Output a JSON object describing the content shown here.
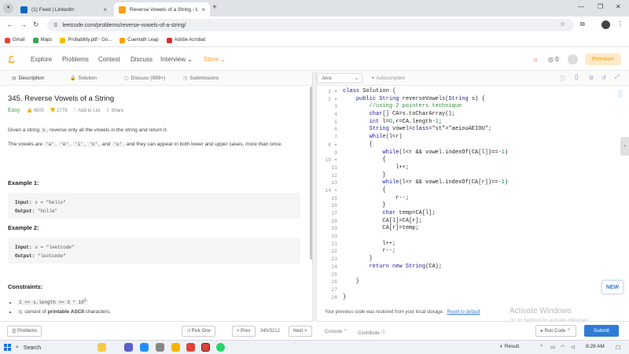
{
  "browser": {
    "tabs": [
      {
        "label": "(1) Feed | LinkedIn",
        "color": "#0a66c2"
      },
      {
        "label": "Reverse Vowels of a String - Lee",
        "color": "#f89f1b"
      }
    ],
    "url": "leetcode.com/problems/reverse-vowels-of-a-string/",
    "bookmarks": [
      {
        "label": "Gmail",
        "color": "#ea4335"
      },
      {
        "label": "Maps",
        "color": "#34a853"
      },
      {
        "label": "Probability.pdf - Go...",
        "color": "#fbbc04"
      },
      {
        "label": "Cuemath Leap",
        "color": "#f4a300"
      },
      {
        "label": "Adobe Acrobat",
        "color": "#d32f2f"
      }
    ]
  },
  "lc_nav": {
    "explore": "Explore",
    "problems": "Problems",
    "contest": "Contest",
    "discuss": "Discuss",
    "interview": "Interview",
    "store": "Store",
    "notif_count": "0",
    "premium": "Premium"
  },
  "left_tabs": {
    "description": "Description",
    "solution": "Solution",
    "discuss": "Discuss (999+)",
    "submissions": "Submissions"
  },
  "question": {
    "title": "345. Reverse Vowels of a String",
    "difficulty": "Easy",
    "likes": "4500",
    "dislikes": "2778",
    "add_to_list": "Add to List",
    "share": "Share",
    "desc_1": "Given a string ",
    "desc_1_code": "s",
    "desc_1_end": ", reverse only all the vowels in the string and return it.",
    "desc_2_start": "The vowels are ",
    "vowels": [
      "'a'",
      "'e'",
      "'i'",
      "'o'",
      "'u'"
    ],
    "desc_2_end": ", and they can appear in both lower and upper cases, more than once.",
    "example1_heading": "Example 1:",
    "example1_input": "s = \"hello\"",
    "example1_output": "\"holle\"",
    "example2_heading": "Example 2:",
    "example2_input": "s = \"leetcode\"",
    "example2_output": "\"leotcede\"",
    "input_label": "Input:",
    "output_label": "Output:",
    "constraints_heading": "Constraints:",
    "constraint_1": "1 <= s.length <= 3 * 10",
    "constraint_1_exp": "5",
    "constraint_2_code": "s",
    "constraint_2_a": " consist of ",
    "constraint_2_b": "printable ASCII",
    "constraint_2_c": " characters."
  },
  "left_footer": {
    "problems": "Problems",
    "pick_one": "Pick One",
    "prev": "< Prev",
    "pager": "345/3212",
    "next": "Next >"
  },
  "editor": {
    "language": "Java",
    "autocomplete": "Autocomplete",
    "line_numbers": [
      "1",
      "2",
      "3",
      "4",
      "5",
      "6",
      "7",
      "8",
      "9",
      "10",
      "11",
      "12",
      "13",
      "14",
      "15",
      "16",
      "17",
      "18",
      "19",
      "20",
      "21",
      "22",
      "23",
      "24",
      "25",
      "26",
      "27",
      "28"
    ],
    "fold_markers": [
      "1",
      "2",
      "8",
      "10",
      "14"
    ],
    "lines": [
      "class Solution {",
      "    public String reverseVowels(String s) {",
      "        //using 2 pointers technique",
      "        char[] CA=s.toCharArray();",
      "        int l=0,r=CA.length-1;",
      "        String vowel=\"aeiouAEIOU\";",
      "        while(l<r)",
      "        {",
      "            while(l<r && vowel.indexOf(CA[l])==-1)",
      "            {",
      "                l++;",
      "            }",
      "            while(l<r && vowel.indexOf(CA[r])==-1)",
      "            {",
      "                r--;",
      "            }",
      "            char temp=CA[l];",
      "            CA[l]=CA[r];",
      "            CA[r]=temp;",
      "",
      "            l++;",
      "            r--;",
      "        }",
      "        return new String(CA);",
      "",
      "    }",
      "",
      "}"
    ],
    "status_text": "Your previous code was restored from your local storage.",
    "status_link": "Reset to default",
    "new_badge": "NEW",
    "watermark_title": "Activate Windows",
    "watermark_sub": "Go to Settings to activate Windows."
  },
  "right_footer": {
    "console": "Console",
    "contribute": "Contribute",
    "run_code": "Run Code",
    "submit": "Submit"
  },
  "taskbar": {
    "search": "Search",
    "result": "Result",
    "time": "8:28 AM"
  }
}
